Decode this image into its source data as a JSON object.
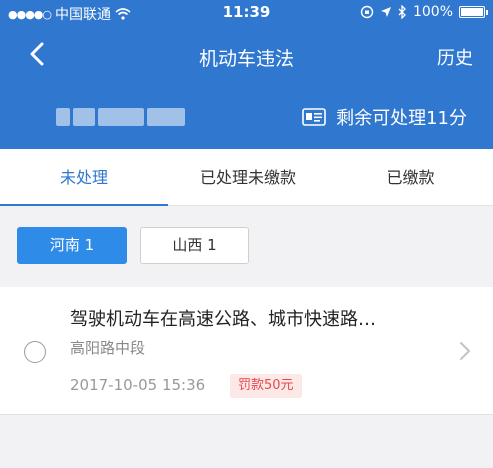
{
  "status_bar": {
    "signal": "●●●●○",
    "carrier": "中国联通",
    "time": "11:39",
    "battery": "100%"
  },
  "nav": {
    "title": "机动车违法",
    "history_label": "历史"
  },
  "summary": {
    "remaining_points": "剩余可处理11分"
  },
  "tabs": [
    {
      "label": "未处理",
      "active": true
    },
    {
      "label": "已处理未缴款",
      "active": false
    },
    {
      "label": "已缴款",
      "active": false
    }
  ],
  "regions": [
    {
      "label": "河南 1",
      "active": true
    },
    {
      "label": "山西 1",
      "active": false
    }
  ],
  "violations": [
    {
      "title": "驾驶机动车在高速公路、城市快速路…",
      "location": "高阳路中段",
      "datetime": "2017-10-05 15:36",
      "fine": "罚款50元"
    }
  ],
  "colors": {
    "primary": "#2f77cf",
    "chip_active": "#2f8be8",
    "fine_text": "#e8484b",
    "fine_bg": "#fde8e8"
  }
}
